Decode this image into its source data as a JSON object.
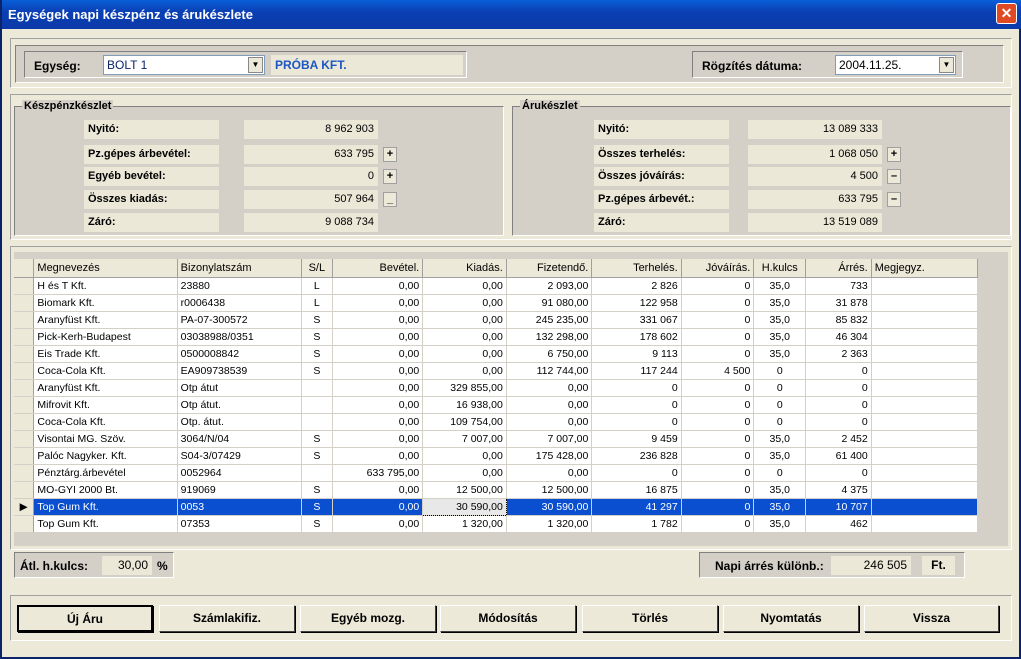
{
  "window": {
    "title": "Egységek napi készpénz és árukészlete",
    "close": "✕"
  },
  "header": {
    "unit_label": "Egység:",
    "unit_value": "BOLT 1",
    "company": "PRÓBA KFT.",
    "date_label": "Rögzítés dátuma:",
    "date_value": "2004.11.25."
  },
  "cash": {
    "title": "Készpénzkészlet",
    "rows": [
      {
        "label": "Nyitó:",
        "value": "8 962 903",
        "sign": ""
      },
      {
        "label": "Pz.gépes árbevétel:",
        "value": "633 795",
        "sign": "+"
      },
      {
        "label": "Egyéb bevétel:",
        "value": "0",
        "sign": "+"
      },
      {
        "label": "Összes kiadás:",
        "value": "507 964",
        "sign": "_"
      },
      {
        "label": "Záró:",
        "value": "9 088 734",
        "sign": ""
      }
    ]
  },
  "stock": {
    "title": "Árukészlet",
    "rows": [
      {
        "label": "Nyitó:",
        "value": "13 089 333",
        "sign": ""
      },
      {
        "label": "Összes terhelés:",
        "value": "1 068 050",
        "sign": "+"
      },
      {
        "label": "Összes jóváírás:",
        "value": "4 500",
        "sign": "–"
      },
      {
        "label": "Pz.gépes árbevét.:",
        "value": "633 795",
        "sign": "–"
      },
      {
        "label": "Záró:",
        "value": "13 519 089",
        "sign": ""
      }
    ]
  },
  "grid": {
    "columns": [
      "Megnevezés",
      "Bizonylatszám",
      "S/L",
      "Bevétel.",
      "Kiadás.",
      "Fizetendő.",
      "Terhelés.",
      "Jóváírás.",
      "H.kulcs",
      "Árrés.",
      "Megjegyz."
    ],
    "rows": [
      [
        "H és T Kft.",
        "23880",
        "L",
        "0,00",
        "0,00",
        "2 093,00",
        "2 826",
        "0",
        "35,0",
        "733",
        ""
      ],
      [
        "Biomark Kft.",
        "r0006438",
        "L",
        "0,00",
        "0,00",
        "91 080,00",
        "122 958",
        "0",
        "35,0",
        "31 878",
        ""
      ],
      [
        "Aranyfüst Kft.",
        "PA-07-300572",
        "S",
        "0,00",
        "0,00",
        "245 235,00",
        "331 067",
        "0",
        "35,0",
        "85 832",
        ""
      ],
      [
        "Pick-Kerh-Budapest",
        "03038988/0351",
        "S",
        "0,00",
        "0,00",
        "132 298,00",
        "178 602",
        "0",
        "35,0",
        "46 304",
        ""
      ],
      [
        "Eis Trade Kft.",
        "0500008842",
        "S",
        "0,00",
        "0,00",
        "6 750,00",
        "9 113",
        "0",
        "35,0",
        "2 363",
        ""
      ],
      [
        "Coca-Cola Kft.",
        "EA909738539",
        "S",
        "0,00",
        "0,00",
        "112 744,00",
        "117 244",
        "4 500",
        "0",
        "0",
        ""
      ],
      [
        "Aranyfüst Kft.",
        "Otp átut",
        "",
        "0,00",
        "329 855,00",
        "0,00",
        "0",
        "0",
        "0",
        "0",
        ""
      ],
      [
        "Mifrovit Kft.",
        "Otp átut.",
        "",
        "0,00",
        "16 938,00",
        "0,00",
        "0",
        "0",
        "0",
        "0",
        ""
      ],
      [
        "Coca-Cola Kft.",
        "Otp. átut.",
        "",
        "0,00",
        "109 754,00",
        "0,00",
        "0",
        "0",
        "0",
        "0",
        ""
      ],
      [
        "Visontai MG. Szöv.",
        "3064/N/04",
        "S",
        "0,00",
        "7 007,00",
        "7 007,00",
        "9 459",
        "0",
        "35,0",
        "2 452",
        ""
      ],
      [
        "Palóc Nagyker. Kft.",
        "S04-3/07429",
        "S",
        "0,00",
        "0,00",
        "175 428,00",
        "236 828",
        "0",
        "35,0",
        "61 400",
        ""
      ],
      [
        "Pénztárg.árbevétel",
        "0052964",
        "",
        "633 795,00",
        "0,00",
        "0,00",
        "0",
        "0",
        "0",
        "0",
        ""
      ],
      [
        "MO-GYI 2000 Bt.",
        "919069",
        "S",
        "0,00",
        "12 500,00",
        "12 500,00",
        "16 875",
        "0",
        "35,0",
        "4 375",
        ""
      ],
      [
        "Top Gum Kft.",
        "0053",
        "S",
        "0,00",
        "30 590,00",
        "30 590,00",
        "41 297",
        "0",
        "35,0",
        "10 707",
        ""
      ],
      [
        "Top Gum Kft.",
        "07353",
        "S",
        "0,00",
        "1 320,00",
        "1 320,00",
        "1 782",
        "0",
        "35,0",
        "462",
        ""
      ]
    ],
    "selected_row": 13,
    "current_marker": "▶"
  },
  "footer": {
    "avg_label": "Átl. h.kulcs:",
    "avg_value": "30,00",
    "avg_unit": "%",
    "margin_label": "Napi árrés különb.:",
    "margin_value": "246 505",
    "margin_unit": "Ft."
  },
  "buttons": [
    "Új Áru",
    "Számlakifiz.",
    "Egyéb mozg.",
    "Módosítás",
    "Törlés",
    "Nyomtatás",
    "Vissza"
  ]
}
